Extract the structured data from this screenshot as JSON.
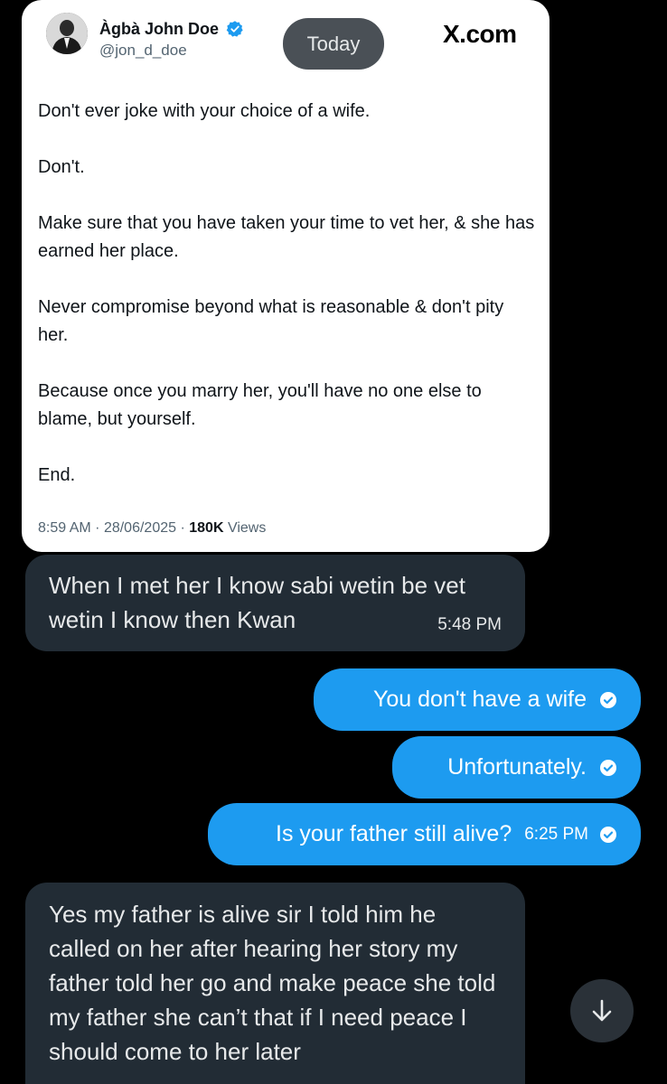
{
  "tweet": {
    "author_name": "Àgbà John Doe",
    "author_handle": "@jon_d_doe",
    "brand": "X.com",
    "date_pill": "Today",
    "paragraphs": [
      "Don't ever joke with your choice of a wife.",
      "Don't.",
      "Make sure that you have taken your time to vet her, & she has earned her place.",
      "Never compromise beyond what is reasonable & don't pity her.",
      "Because once you marry her, you'll have no one else to blame, but yourself.",
      "End."
    ],
    "time": "8:59 AM",
    "date": "28/06/2025",
    "views_count": "180K",
    "views_label": "Views",
    "separator": "·"
  },
  "messages": [
    {
      "direction": "in",
      "text": "When I met her I know sabi wetin be vet wetin I know then Kwan",
      "time": "5:48 PM"
    },
    {
      "direction": "out",
      "text": "You don't have a wife",
      "time": ""
    },
    {
      "direction": "out",
      "text": "Unfortunately.",
      "time": ""
    },
    {
      "direction": "out",
      "text": "Is your father still alive?",
      "time": "6:25 PM"
    },
    {
      "direction": "in",
      "text": "Yes my father is alive sir I told him he called on her after hearing her story my father told her go and make peace she told my father she can’t that if I need peace I should come to her later",
      "time": ""
    }
  ],
  "icons": {
    "verified": "verified-badge-icon",
    "read_receipt": "check-circle-icon",
    "scroll_down": "arrow-down-icon"
  },
  "colors": {
    "outgoing_bubble": "#1d9bf0",
    "incoming_bubble": "#222c35",
    "background": "#000000",
    "verified": "#1d9bf0"
  }
}
